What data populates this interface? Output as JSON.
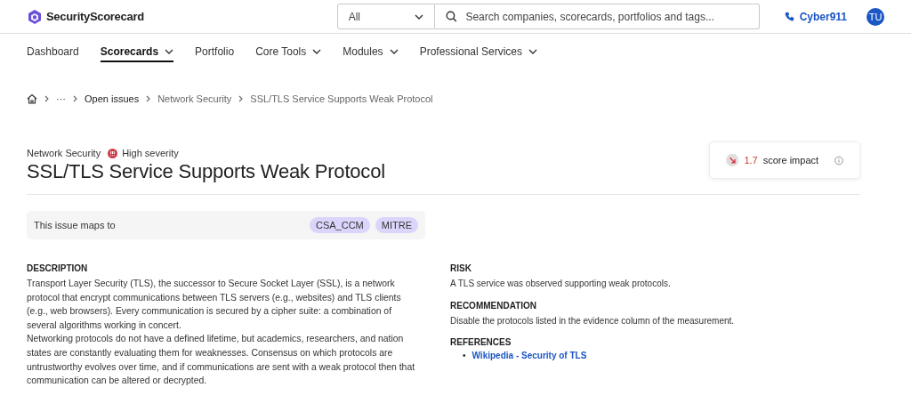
{
  "header": {
    "logo": "SecurityScorecard",
    "search_scope": "All",
    "search": {
      "placeholder": "Search companies, scorecards, portfolios and tags..."
    },
    "phone_link": "Cyber911",
    "avatar": "TU"
  },
  "nav": [
    {
      "label": "Dashboard",
      "selected": false,
      "dropdown": false
    },
    {
      "label": "Scorecards",
      "selected": true,
      "dropdown": true
    },
    {
      "label": "Portfolio",
      "selected": false,
      "dropdown": false
    },
    {
      "label": "Core Tools",
      "selected": false,
      "dropdown": true
    },
    {
      "label": "Modules",
      "selected": false,
      "dropdown": true
    },
    {
      "label": "Professional Services",
      "selected": false,
      "dropdown": true
    }
  ],
  "breadcrumbs": [
    {
      "label": "···",
      "kind": "more"
    },
    {
      "label": "Open issues",
      "kind": "link"
    },
    {
      "label": "Network Security",
      "kind": "plain"
    },
    {
      "label": "SSL/TLS Service Supports Weak Protocol",
      "kind": "plain"
    }
  ],
  "issue": {
    "category": "Network Security",
    "severity": "High severity",
    "title": "SSL/TLS Service Supports Weak Protocol",
    "score_impact": {
      "value": "1.7",
      "label": "score impact"
    },
    "maps": {
      "label": "This issue maps to",
      "tags": [
        "CSA_CCM",
        "MITRE"
      ]
    }
  },
  "description": {
    "heading": "DESCRIPTION",
    "paragraphs": [
      "Transport Layer Security (TLS), the successor to Secure Socket Layer (SSL), is a network protocol that encrypt communications between TLS servers (e.g., websites) and TLS clients (e.g., web browsers). Every communication is secured by a cipher suite: a combination of several algorithms working in concert.",
      "Networking protocols do not have a defined lifetime, but academics, researchers, and nation states are constantly evaluating them for weaknesses. Consensus on which protocols are untrustworthy evolves over time, and if communications are sent with a weak protocol then that communication can be altered or decrypted."
    ]
  },
  "risk": {
    "heading": "RISK",
    "text": "A TLS service was observed supporting weak protocols."
  },
  "recommendation": {
    "heading": "RECOMMENDATION",
    "text": "Disable the protocols listed in the evidence column of the measurement."
  },
  "references": {
    "heading": "REFERENCES",
    "links": [
      {
        "marker": "•",
        "label": "Wikipedia - Security of TLS"
      }
    ]
  }
}
